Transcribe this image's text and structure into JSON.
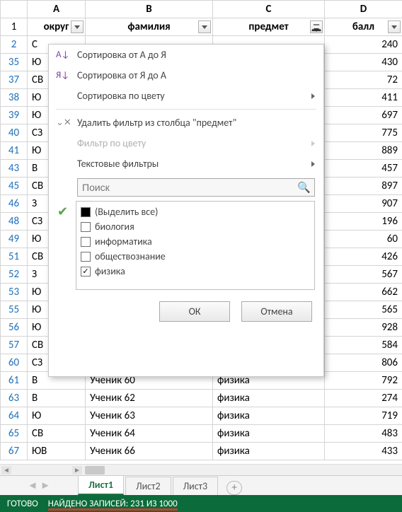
{
  "columns": {
    "A": "округ",
    "B": "фамилия",
    "C": "предмет",
    "D": "балл"
  },
  "rows": [
    {
      "n": 1,
      "header": true
    },
    {
      "n": 2,
      "a": "С",
      "d": 240
    },
    {
      "n": 35,
      "a": "Ю",
      "d": 430
    },
    {
      "n": 37,
      "a": "СВ",
      "d": 72
    },
    {
      "n": 38,
      "a": "Ю",
      "d": 411
    },
    {
      "n": 39,
      "a": "Ю",
      "d": 697
    },
    {
      "n": 40,
      "a": "СЗ",
      "d": 775
    },
    {
      "n": 41,
      "a": "Ю",
      "d": 889
    },
    {
      "n": 43,
      "a": "В",
      "d": 457
    },
    {
      "n": 45,
      "a": "СВ",
      "d": 897
    },
    {
      "n": 46,
      "a": "З",
      "d": 907
    },
    {
      "n": 48,
      "a": "СЗ",
      "d": 196
    },
    {
      "n": 49,
      "a": "Ю",
      "d": 60
    },
    {
      "n": 51,
      "a": "СВ",
      "d": 426
    },
    {
      "n": 52,
      "a": "З",
      "d": 567
    },
    {
      "n": 53,
      "a": "Ю",
      "d": 662
    },
    {
      "n": 55,
      "a": "Ю",
      "d": 565
    },
    {
      "n": 56,
      "a": "Ю",
      "d": 928
    },
    {
      "n": 57,
      "a": "СВ",
      "d": 584
    },
    {
      "n": 60,
      "a": "СЗ",
      "d": 806
    },
    {
      "n": 61,
      "a": "В",
      "b": "Ученик 60",
      "c": "физика",
      "d": 792
    },
    {
      "n": 63,
      "a": "В",
      "b": "Ученик 62",
      "c": "физика",
      "d": 274
    },
    {
      "n": 64,
      "a": "Ю",
      "b": "Ученик 63",
      "c": "физика",
      "d": 719
    },
    {
      "n": 65,
      "a": "СВ",
      "b": "Ученик 64",
      "c": "физика",
      "d": 483
    },
    {
      "n": 67,
      "a": "ЮВ",
      "b": "Ученик 66",
      "c": "физика",
      "d": 433
    }
  ],
  "dropdown": {
    "sort_az": "Сортировка от А до Я",
    "sort_za": "Сортировка от Я до А",
    "sort_color": "Сортировка по цвету",
    "clear_filter": "Удалить фильтр из столбца \"предмет\"",
    "filter_color": "Фильтр по цвету",
    "text_filters": "Текстовые фильтры",
    "search_placeholder": "Поиск",
    "items": [
      "(Выделить все)",
      "биология",
      "информатика",
      "обществознание",
      "физика"
    ],
    "checked": [
      false,
      false,
      false,
      false,
      true
    ],
    "tri": [
      true,
      false,
      false,
      false,
      false
    ],
    "ok": "ОК",
    "cancel": "Отмена"
  },
  "tabs": {
    "t1": "Лист1",
    "t2": "Лист2",
    "t3": "Лист3"
  },
  "status": {
    "ready": "ГОТОВО",
    "found": "НАЙДЕНО ЗАПИСЕЙ: 231 ИЗ 1000"
  }
}
